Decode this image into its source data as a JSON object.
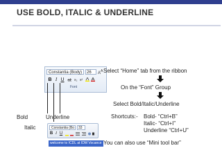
{
  "slide": {
    "title": "USE BOLD, ITALIC & UNDERLINE"
  },
  "ribbon": {
    "font_name": "Constantia (Body)",
    "font_size": "26",
    "group_label": "Font",
    "bold_glyph": "B",
    "italic_glyph": "I",
    "underline_glyph": "U"
  },
  "pointers": {
    "bold": "Bold",
    "italic": "Italic",
    "underline": "Underline"
  },
  "mini_toolbar": {
    "font_name": "Constantia (Bo",
    "font_size": "33",
    "bold_glyph": "B",
    "italic_glyph": "I",
    "underline_glyph": "U",
    "doc_text": "welcome to ICDL at IDM Vocance"
  },
  "steps": {
    "step1": "Select “Home” tab from the ribbon",
    "step2": "On the “Font” Group",
    "step3": "Select Bold/Italic/Underline",
    "shortcuts_label": "Shortcuts:-",
    "shortcut_bold": "Bold- “Ctrl+B”",
    "shortcut_italic": "Italic- “Ctrl+I”",
    "shortcut_underline": "Underline “Ctrl+U”",
    "mini_note": "You  can also use “Mini tool bar”"
  },
  "colors": {
    "accent": "#2f3f8f",
    "ribbon_border": "#a9bcd5",
    "highlight": "#3a65c9"
  }
}
